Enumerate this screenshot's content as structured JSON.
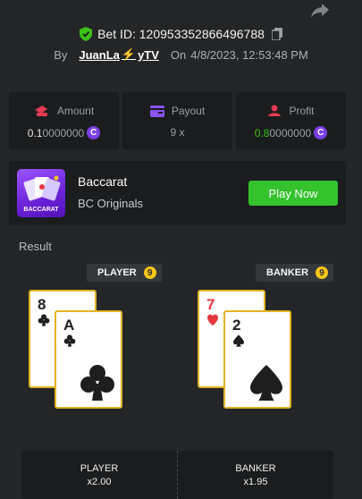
{
  "header": {
    "bet_id": "Bet ID: 120953352866496788",
    "by_label": "By",
    "user_name_a": "JuanLa",
    "user_bolt": "⚡",
    "user_name_b": "yTV",
    "on_label": "On",
    "timestamp": "4/8/2023, 12:53:48 PM"
  },
  "stats": {
    "amount": {
      "label": "Amount",
      "value_main": "0.1",
      "value_faded": "0000000"
    },
    "payout": {
      "label": "Payout",
      "value": "9 x"
    },
    "profit": {
      "label": "Profit",
      "value_main": "0.8",
      "value_faded": "0000000"
    }
  },
  "currency_symbol": "C",
  "game": {
    "name": "Baccarat",
    "provider": "BC Originals",
    "thumb_label": "BACCARAT",
    "play_label": "Play Now"
  },
  "result": {
    "title": "Result",
    "player": {
      "label": "PLAYER",
      "score": "9",
      "cards": [
        {
          "rank": "8",
          "suit": "clubs"
        },
        {
          "rank": "A",
          "suit": "clubs"
        }
      ]
    },
    "banker": {
      "label": "BANKER",
      "score": "9",
      "cards": [
        {
          "rank": "7",
          "suit": "hearts"
        },
        {
          "rank": "2",
          "suit": "spades"
        }
      ]
    }
  },
  "bets": {
    "player": {
      "label": "PLAYER",
      "odds": "x2.00"
    },
    "banker": {
      "label": "BANKER",
      "odds": "x1.95"
    }
  },
  "colors": {
    "background": "#232527",
    "panel": "#1a1c1e",
    "play_button": "#34c22d",
    "profit_green": "#3bc117",
    "coin_purple": "#7a3fe4",
    "card_border": "#e2b224",
    "score_yellow": "#f6c719",
    "red_suit": "#e8363d"
  }
}
